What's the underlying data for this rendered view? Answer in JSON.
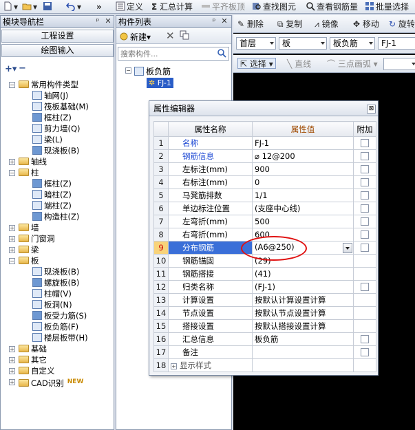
{
  "toolbar": {
    "define": "定义",
    "sum_calc": "汇总计算",
    "level_plate": "平齐板顶",
    "find_element": "查找图元",
    "view_rebar": "查看钢筋量",
    "batch_select": "批量选择"
  },
  "nav": {
    "title": "模块导航栏",
    "project_settings": "工程设置",
    "drawing_input": "绘图输入",
    "tree": [
      {
        "label": "常用构件类型",
        "kind": "folder",
        "level": 0,
        "state": "-"
      },
      {
        "label": "轴网(J)",
        "kind": "item",
        "level": 1
      },
      {
        "label": "筏板基础(M)",
        "kind": "item",
        "level": 1
      },
      {
        "label": "框柱(Z)",
        "kind": "item",
        "level": 1
      },
      {
        "label": "剪力墙(Q)",
        "kind": "item",
        "level": 1
      },
      {
        "label": "梁(L)",
        "kind": "item",
        "level": 1
      },
      {
        "label": "现浇板(B)",
        "kind": "item",
        "level": 1
      },
      {
        "label": "轴线",
        "kind": "folder",
        "level": 0,
        "state": "+"
      },
      {
        "label": "柱",
        "kind": "folder",
        "level": 0,
        "state": "-"
      },
      {
        "label": "框柱(Z)",
        "kind": "item",
        "level": 1
      },
      {
        "label": "暗柱(Z)",
        "kind": "item",
        "level": 1
      },
      {
        "label": "端柱(Z)",
        "kind": "item",
        "level": 1
      },
      {
        "label": "构造柱(Z)",
        "kind": "item",
        "level": 1
      },
      {
        "label": "墙",
        "kind": "folder",
        "level": 0,
        "state": "+"
      },
      {
        "label": "门窗洞",
        "kind": "folder",
        "level": 0,
        "state": "+"
      },
      {
        "label": "梁",
        "kind": "folder",
        "level": 0,
        "state": "+"
      },
      {
        "label": "板",
        "kind": "folder",
        "level": 0,
        "state": "-"
      },
      {
        "label": "现浇板(B)",
        "kind": "item",
        "level": 1
      },
      {
        "label": "螺旋板(B)",
        "kind": "item",
        "level": 1
      },
      {
        "label": "柱帽(V)",
        "kind": "item",
        "level": 1
      },
      {
        "label": "板洞(N)",
        "kind": "item",
        "level": 1
      },
      {
        "label": "板受力筋(S)",
        "kind": "item",
        "level": 1
      },
      {
        "label": "板负筋(F)",
        "kind": "item",
        "level": 1
      },
      {
        "label": "楼层板带(H)",
        "kind": "item",
        "level": 1
      },
      {
        "label": "基础",
        "kind": "folder",
        "level": 0,
        "state": "+"
      },
      {
        "label": "其它",
        "kind": "folder",
        "level": 0,
        "state": "+"
      },
      {
        "label": "自定义",
        "kind": "folder",
        "level": 0,
        "state": "+"
      },
      {
        "label": "CAD识别",
        "kind": "folder",
        "level": 0,
        "state": "+"
      }
    ],
    "new_badge": "NEW"
  },
  "comp": {
    "title": "构件列表",
    "new_label": "新建",
    "search_placeholder": "搜索构件...",
    "root": "板负筋",
    "child": "FJ-1"
  },
  "draw": {
    "delete": "删除",
    "copy": "复制",
    "mirror": "镜像",
    "move": "移动",
    "rotate": "旋转",
    "floor": "首层",
    "type": "板",
    "subtype": "板负筋",
    "element": "FJ-1",
    "select": "选择",
    "line": "直线",
    "arc": "三点画弧"
  },
  "dialog": {
    "title": "属性编辑器",
    "col_name": "属性名称",
    "col_value": "属性值",
    "col_add": "附加",
    "rows": [
      {
        "num": "1",
        "name": "名称",
        "value": "FJ-1"
      },
      {
        "num": "2",
        "name": "钢筋信息",
        "value": " 12@200"
      },
      {
        "num": "3",
        "name": "左标注(mm)",
        "value": "900"
      },
      {
        "num": "4",
        "name": "右标注(mm)",
        "value": "0"
      },
      {
        "num": "5",
        "name": "马凳筋排数",
        "value": "1/1"
      },
      {
        "num": "6",
        "name": "单边标注位置",
        "value": "(支座中心线)"
      },
      {
        "num": "7",
        "name": "左弯折(mm)",
        "value": "500"
      },
      {
        "num": "8",
        "name": "右弯折(mm)",
        "value": "600"
      },
      {
        "num": "9",
        "name": "分布钢筋",
        "value": "(A6@250)"
      },
      {
        "num": "10",
        "name": "钢筋锚固",
        "value": "(29)"
      },
      {
        "num": "11",
        "name": "钢筋搭接",
        "value": "(41)"
      },
      {
        "num": "12",
        "name": "归类名称",
        "value": "(FJ-1)"
      },
      {
        "num": "13",
        "name": "计算设置",
        "value": "按默认计算设置计算"
      },
      {
        "num": "14",
        "name": "节点设置",
        "value": "按默认节点设置计算"
      },
      {
        "num": "15",
        "name": "搭接设置",
        "value": "按默认搭接设置计算"
      },
      {
        "num": "16",
        "name": "汇总信息",
        "value": "板负筋"
      },
      {
        "num": "17",
        "name": "备注",
        "value": ""
      },
      {
        "num": "18",
        "name": "显示样式",
        "value": ""
      }
    ]
  }
}
